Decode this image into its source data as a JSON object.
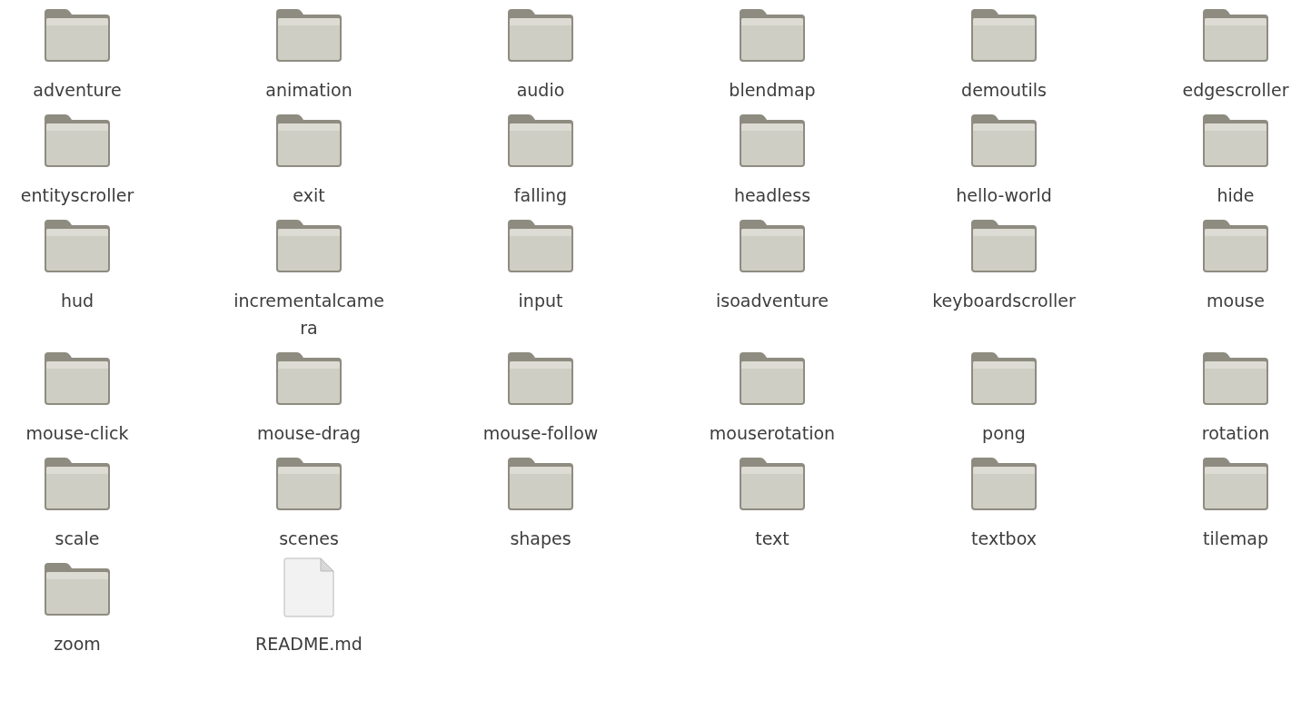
{
  "items": [
    {
      "kind": "folder",
      "name": "adventure"
    },
    {
      "kind": "folder",
      "name": "animation"
    },
    {
      "kind": "folder",
      "name": "audio"
    },
    {
      "kind": "folder",
      "name": "blendmap"
    },
    {
      "kind": "folder",
      "name": "demoutils"
    },
    {
      "kind": "folder",
      "name": "edgescroller"
    },
    {
      "kind": "folder",
      "name": "entityscroller"
    },
    {
      "kind": "folder",
      "name": "exit"
    },
    {
      "kind": "folder",
      "name": "falling"
    },
    {
      "kind": "folder",
      "name": "headless"
    },
    {
      "kind": "folder",
      "name": "hello-world"
    },
    {
      "kind": "folder",
      "name": "hide"
    },
    {
      "kind": "folder",
      "name": "hud"
    },
    {
      "kind": "folder",
      "name": "incrementalcamera"
    },
    {
      "kind": "folder",
      "name": "input"
    },
    {
      "kind": "folder",
      "name": "isoadventure"
    },
    {
      "kind": "folder",
      "name": "keyboardscroller"
    },
    {
      "kind": "folder",
      "name": "mouse"
    },
    {
      "kind": "folder",
      "name": "mouse-click"
    },
    {
      "kind": "folder",
      "name": "mouse-drag"
    },
    {
      "kind": "folder",
      "name": "mouse-follow"
    },
    {
      "kind": "folder",
      "name": "mouserotation"
    },
    {
      "kind": "folder",
      "name": "pong"
    },
    {
      "kind": "folder",
      "name": "rotation"
    },
    {
      "kind": "folder",
      "name": "scale"
    },
    {
      "kind": "folder",
      "name": "scenes"
    },
    {
      "kind": "folder",
      "name": "shapes"
    },
    {
      "kind": "folder",
      "name": "text"
    },
    {
      "kind": "folder",
      "name": "textbox"
    },
    {
      "kind": "folder",
      "name": "tilemap"
    },
    {
      "kind": "folder",
      "name": "zoom"
    },
    {
      "kind": "file",
      "name": "README.md"
    }
  ]
}
